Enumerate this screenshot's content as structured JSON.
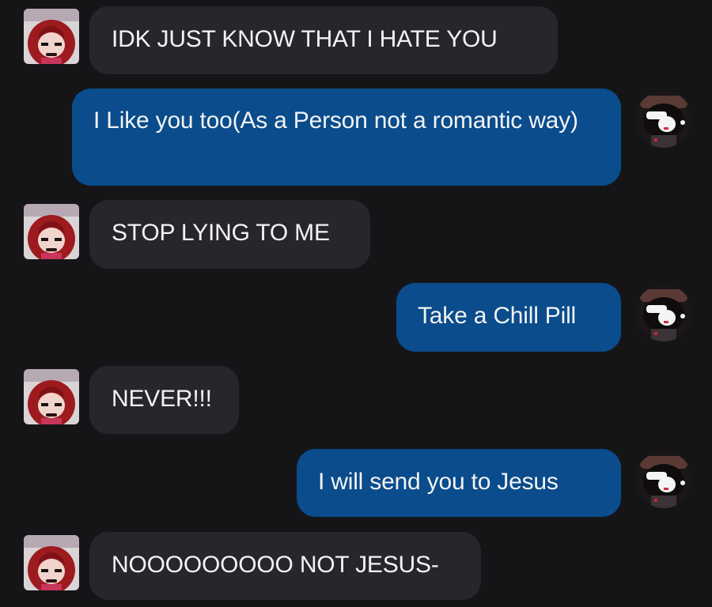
{
  "messages": [
    {
      "direction": "in",
      "text": "IDK JUST KNOW THAT I HATE YOU"
    },
    {
      "direction": "out",
      "text": "I Like you too(As a Person not a romantic way)"
    },
    {
      "direction": "in",
      "text": "STOP LYING TO ME"
    },
    {
      "direction": "out",
      "text": "Take a Chill Pill"
    },
    {
      "direction": "in",
      "text": "NEVER!!!"
    },
    {
      "direction": "out",
      "text": "I will send you to Jesus"
    },
    {
      "direction": "in",
      "text": "NOOOOOOOOO NOT JESUS-"
    }
  ],
  "colors": {
    "background": "#151518",
    "incoming_bubble": "#26272c",
    "outgoing_bubble": "#0a4c8c",
    "text": "#f3f3f3"
  },
  "avatars": {
    "incoming": "red-haired-character-avatar-icon",
    "outgoing": "dark-haired-character-avatar-icon"
  }
}
